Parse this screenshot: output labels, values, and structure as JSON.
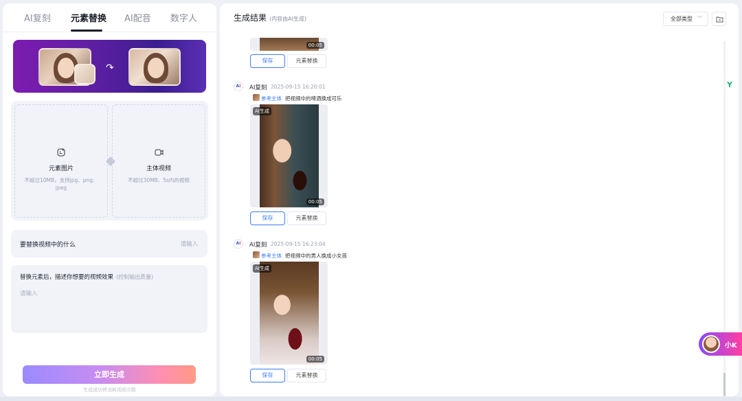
{
  "left_panel": {
    "tabs": [
      {
        "label": "AI复刻"
      },
      {
        "label": "元素替换"
      },
      {
        "label": "AI配音"
      },
      {
        "label": "数字人"
      }
    ],
    "active_tab": "元素替换",
    "upload_element": {
      "title": "元素图片",
      "desc": "不超过10MB，支持jpg、png、jpeg",
      "icon": "image-plus-icon"
    },
    "upload_video": {
      "title": "主体视频",
      "desc": "不超过30MB、5s内的视频",
      "icon": "video-icon"
    },
    "replace_field": {
      "label": "要替换视频中的什么",
      "placeholder": "请输入"
    },
    "effect_field": {
      "label": "替换元素后，描述你想要的视频效果",
      "hint": "(控制输出质量)",
      "placeholder": "请输入"
    },
    "generate_button": "立即生成",
    "generate_note": "生成成功将消耗视频次数"
  },
  "right_panel": {
    "title": "生成结果",
    "subtitle": "(内容由AI生成)",
    "filter_label": "全部类型",
    "results": [
      {
        "duration": "00:05",
        "save_label": "保存",
        "replace_label": "元素替换"
      },
      {
        "author": "AI复刻",
        "time": "2025-09-15 16:20:01",
        "ref_label": "参考主体",
        "ref_text": "把视频中的啤酒换成可乐",
        "ai_tag": "AI生成",
        "duration": "00:05",
        "save_label": "保存",
        "replace_label": "元素替换"
      },
      {
        "author": "AI复刻",
        "time": "2025-09-15 16:23:04",
        "ref_label": "参考主体",
        "ref_text": "把视频中的男人换成小女孩",
        "ai_tag": "AI生成",
        "duration": "00:05",
        "save_label": "保存",
        "replace_label": "元素替换"
      }
    ]
  },
  "assistant": {
    "label": "小K"
  },
  "colors": {
    "accent_blue": "#3a7cf6",
    "brand_purple": "#8c48ff",
    "brand_pink": "#ff3fa0"
  }
}
